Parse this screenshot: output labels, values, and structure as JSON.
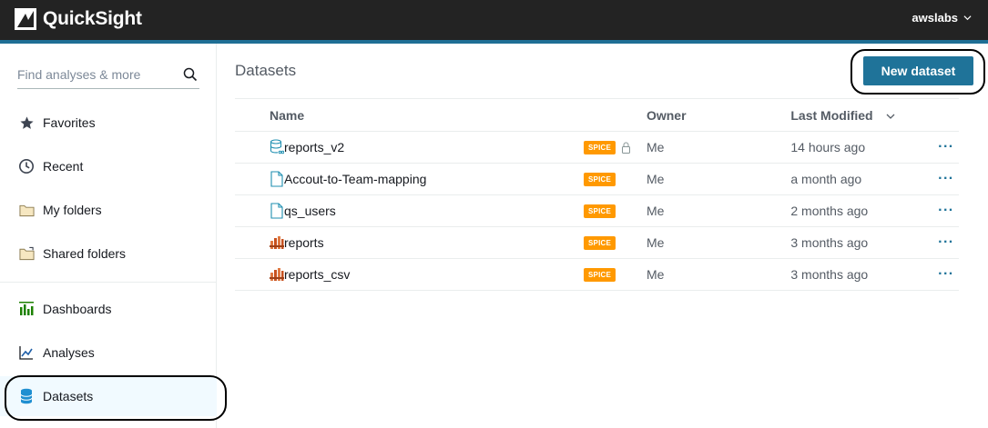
{
  "app": {
    "name": "QuickSight",
    "account": "awslabs"
  },
  "search": {
    "placeholder": "Find analyses & more"
  },
  "sidebar": {
    "items": [
      {
        "label": "Favorites",
        "icon": "star-icon"
      },
      {
        "label": "Recent",
        "icon": "clock-icon"
      },
      {
        "label": "My folders",
        "icon": "folder-icon"
      },
      {
        "label": "Shared folders",
        "icon": "shared-folder-icon"
      },
      {
        "label": "Dashboards",
        "icon": "dashboard-icon"
      },
      {
        "label": "Analyses",
        "icon": "analysis-icon"
      },
      {
        "label": "Datasets",
        "icon": "dataset-icon",
        "active": true
      }
    ]
  },
  "main": {
    "title": "Datasets",
    "new_button": "New dataset",
    "columns": {
      "name": "Name",
      "owner": "Owner",
      "modified": "Last Modified"
    },
    "rows": [
      {
        "name": "reports_v2",
        "badge": "SPICE",
        "locked": true,
        "owner": "Me",
        "modified": "14 hours ago",
        "icon": "database-icon",
        "actions": "···"
      },
      {
        "name": "Accout-to-Team-mapping",
        "badge": "SPICE",
        "locked": false,
        "owner": "Me",
        "modified": "a month ago",
        "icon": "file-icon",
        "actions": "···"
      },
      {
        "name": "qs_users",
        "badge": "SPICE",
        "locked": false,
        "owner": "Me",
        "modified": "2 months ago",
        "icon": "file-icon",
        "actions": "···"
      },
      {
        "name": "reports",
        "badge": "SPICE",
        "locked": false,
        "owner": "Me",
        "modified": "3 months ago",
        "icon": "athena-icon",
        "actions": "···"
      },
      {
        "name": "reports_csv",
        "badge": "SPICE",
        "locked": false,
        "owner": "Me",
        "modified": "3 months ago",
        "icon": "athena-icon",
        "actions": "···"
      }
    ]
  },
  "colors": {
    "topbar": "#232323",
    "accent": "#1f7399",
    "spice": "#ff9900"
  }
}
